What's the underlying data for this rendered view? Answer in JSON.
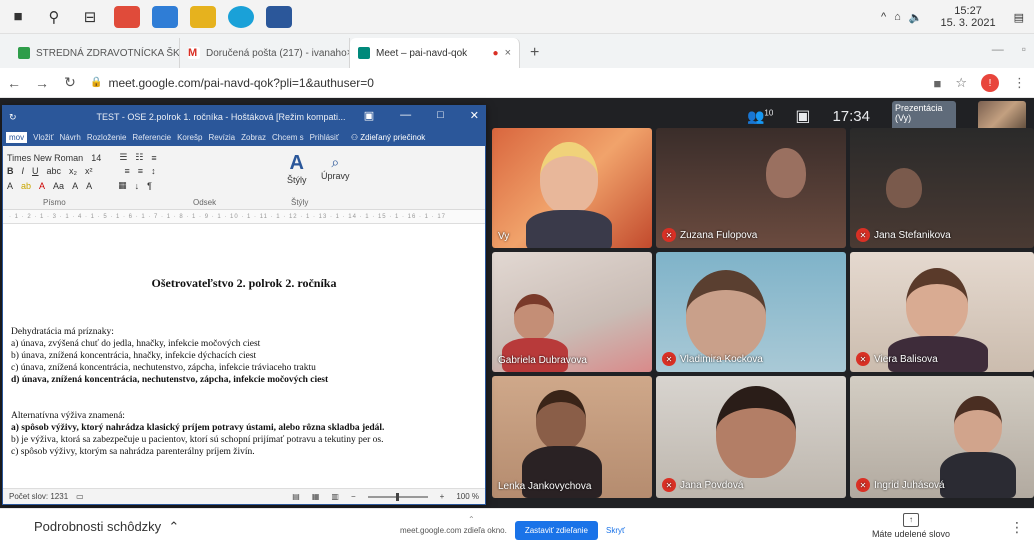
{
  "taskbar": {
    "time": "15:27",
    "date": "15. 3. 2021"
  },
  "browser": {
    "tabs": [
      {
        "label": "STREDNÁ ZDRAVOTNÍCKA ŠKOL",
        "close": "×",
        "color": "#2e9d4a"
      },
      {
        "label": "Doručená pošta (217) - ivanaho",
        "close": "×",
        "color": "#d93025",
        "icon": "M"
      },
      {
        "label": "Meet – pai-navd-qok",
        "close": "×",
        "color": "#00897b"
      }
    ],
    "new_tab": "+",
    "url": "meet.google.com/pai-navd-qok?pli=1&authuser=0"
  },
  "meet": {
    "participant_count": "10",
    "time": "17:34",
    "presentation_label": "Prezentácia (Vy)",
    "tiles": [
      {
        "name": "Vy",
        "muted": false
      },
      {
        "name": "Zuzana Fulopova",
        "muted": true
      },
      {
        "name": "Jana Stefanikova",
        "muted": true
      },
      {
        "name": "Gabriela Dubravova",
        "muted": false
      },
      {
        "name": "Vladimira Kockova",
        "muted": true
      },
      {
        "name": "Viera Balisova",
        "muted": true
      },
      {
        "name": "Lenka Jankovychova",
        "muted": false
      },
      {
        "name": "Jana Povdová",
        "muted": true
      },
      {
        "name": "Ingrid Juhásová",
        "muted": true
      }
    ]
  },
  "word": {
    "title": "TEST - OSE 2.polrok 1. ročníka - Hoštáková [Režim kompati...",
    "menu": [
      "mov",
      "Vložiť",
      "Návrh",
      "Rozloženie",
      "Referencie",
      "Korešp",
      "Revízia",
      "Zobraz",
      "Chcem s",
      "Prihlásiť",
      "Zdieľaný priečinok"
    ],
    "font_name": "Times New Roman",
    "font_size": "14",
    "styles_label": "Štýly",
    "edit_label": "Úpravy",
    "group_font": "Písmo",
    "group_para": "Odsek",
    "group_styles": "Štýly",
    "doc_title": "Ošetrovateľstvo 2. polrok 2. ročníka",
    "q1": "Dehydratácia má príznaky:",
    "q1a": "a)  únava, zvýšená chuť do jedla, hnačky, infekcie močových ciest",
    "q1b": "b)  únava, znížená koncentrácia, hnačky, infekcie dýchacích ciest",
    "q1c": "c)  únava, znížená koncentrácia, nechutenstvo, zápcha, infekcie tráviaceho traktu",
    "q1d": "d)  únava, znížená koncentrácia, nechutenstvo, zápcha, infekcie močových ciest",
    "q2": "Alternatívna výživa znamená:",
    "q2a": "a)  spôsob výživy, ktorý nahrádza klasický príjem potravy ústami, alebo rôzna skladba jedál.",
    "q2b": "b)  je výživa, ktorá sa zabezpečuje u pacientov, ktorí sú schopní prijímať potravu a tekutiny per os.",
    "q2c": "c)  spôsob výživy, ktorým sa nahrádza parenterálny príjem živín.",
    "word_count": "Počet slov: 1231",
    "zoom": "100 %"
  },
  "bottom": {
    "details": "Podrobnosti schôdzky",
    "sharing_text": "meet.google.com zdieľa okno.",
    "stop_sharing": "Zastaviť zdieľanie",
    "hide": "Skryť",
    "presenter": "Máte udelené slovo"
  }
}
